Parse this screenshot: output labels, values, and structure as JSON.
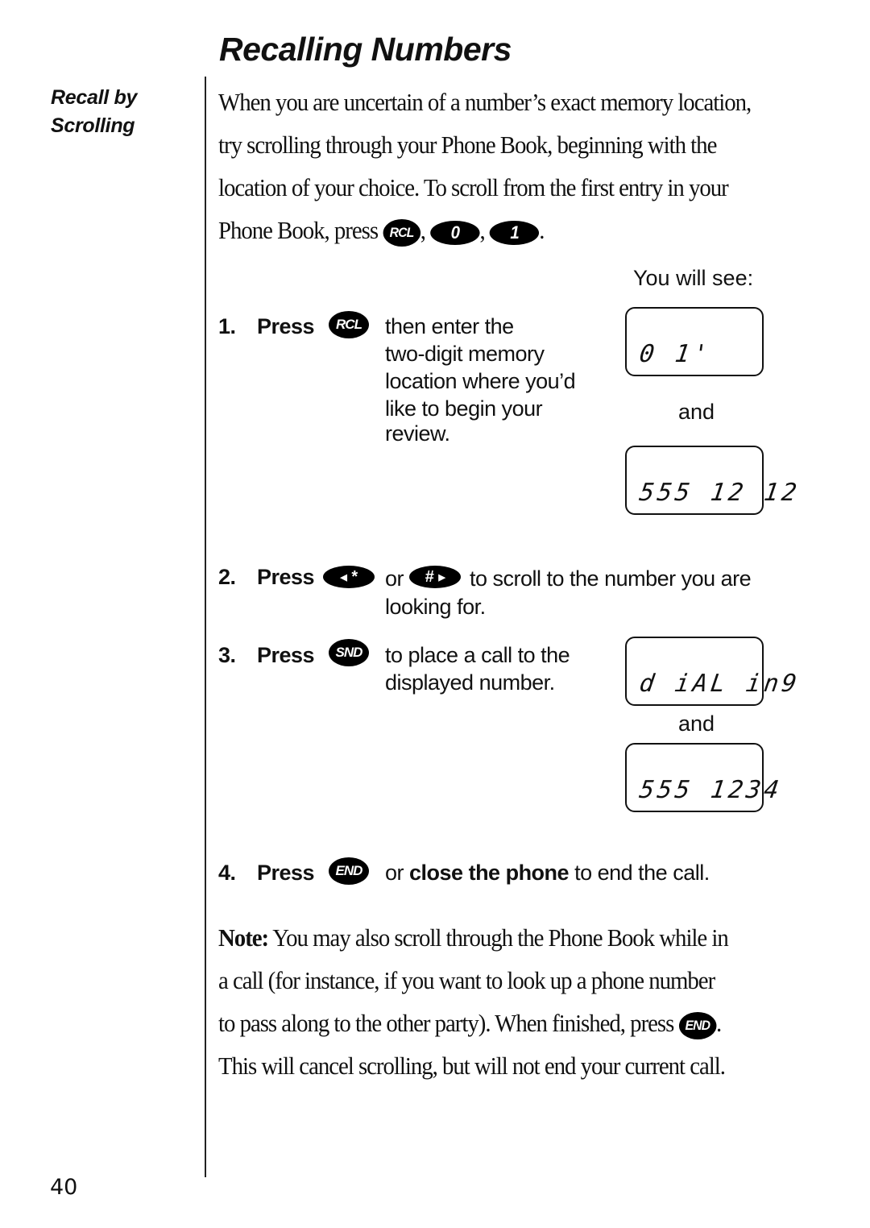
{
  "page": {
    "title": "Recalling Numbers",
    "side_heading_line1": "Recall by",
    "side_heading_line2": "Scrolling",
    "page_number": "40"
  },
  "intro": {
    "line1": "When you are uncertain of a number’s exact memory location,",
    "line2": "try scrolling through your Phone Book, beginning with the",
    "line3": "location of your choice. To scroll from the first entry in your",
    "line4_prefix": "Phone Book, press",
    "keys": [
      "RCL",
      "0",
      "1"
    ],
    "separator": ",",
    "end": "."
  },
  "you_will_see": "You will see:",
  "steps": [
    {
      "number": "1.",
      "press": "Press",
      "key": "RCL",
      "lines": [
        "then enter the",
        "two-digit memory",
        "location where you’d",
        "like to begin your",
        "review."
      ]
    },
    {
      "number": "2.",
      "press": "Press",
      "key_left": "*",
      "key_left_arrow": "◀",
      "or": "or",
      "key_right": "#",
      "key_right_arrow": "▶",
      "line1": "to scroll to the number you are",
      "line2": "looking for."
    },
    {
      "number": "3.",
      "press": "Press",
      "key": "SND",
      "lines": [
        "to place a call to the",
        "displayed number."
      ]
    },
    {
      "number": "4.",
      "press": "Press",
      "key": "END",
      "or": "or",
      "bold_text": "close the phone",
      "rest": "to end the call."
    }
  ],
  "displays": [
    {
      "text": "0 1'"
    },
    {
      "text": "555 12 12"
    },
    {
      "text": "d iAL in9"
    },
    {
      "text": "555 1234"
    }
  ],
  "and_label": "and",
  "note": {
    "label": "Note:",
    "line1": "You may also scroll through the Phone Book while in",
    "line2": "a call (for instance, if you want to look up a phone number",
    "line3_prefix": "to pass along to the other party). When finished, press",
    "line3_key": "END",
    "line3_end": ".",
    "line4": "This will cancel scrolling, but will not end your current call."
  }
}
